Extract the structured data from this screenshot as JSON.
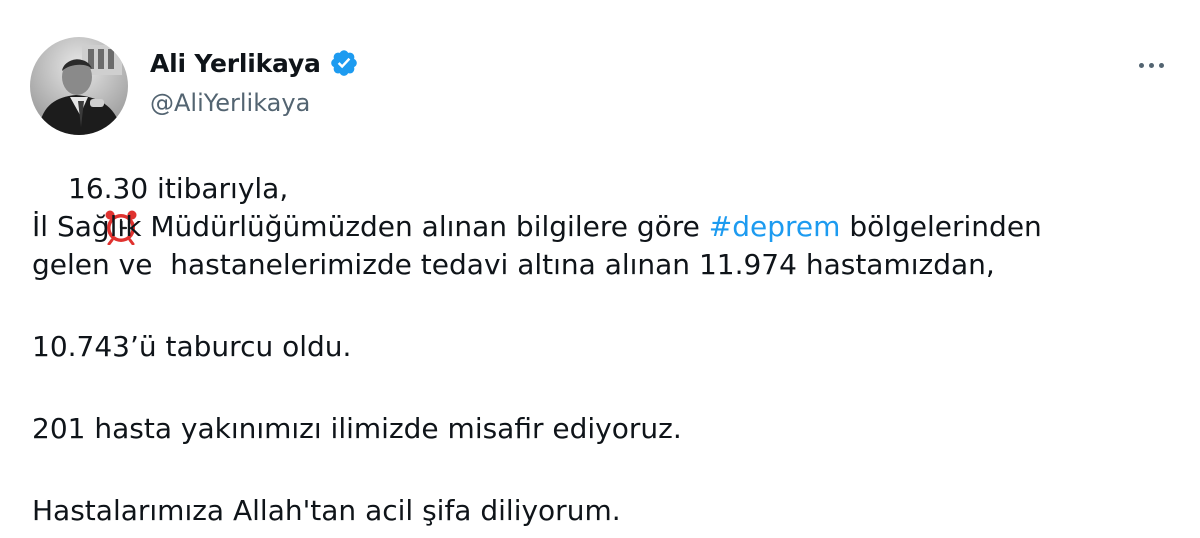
{
  "author": {
    "name": "Ali Yerlikaya",
    "handle": "@AliYerlikaya",
    "verified": true,
    "avatar_icon": "profile-photo"
  },
  "menu": {
    "icon": "more-horizontal-icon"
  },
  "tweet": {
    "line1_text": "16.30 itibarıyla,",
    "line1_icon": "alarm-clock-icon",
    "line2_before": "İl Sağlık Müdürlüğümüzden alınan bilgilere göre ",
    "line2_hashtag": "#deprem",
    "line2_after": " bölgelerinden",
    "line3": "gelen ve  hastanelerimizde tedavi altına alınan 11.974 hastamızdan,",
    "para2": "10.743’ü taburcu oldu.",
    "para3": "201 hasta yakınımızı ilimizde misafir ediyoruz.",
    "para4": "Hastalarımıza Allah'tan acil şifa diliyorum."
  },
  "colors": {
    "text": "#0f1419",
    "secondary": "#536471",
    "link": "#1d9bf0",
    "verified": "#1d9bf0",
    "clock": "#e0322f"
  }
}
